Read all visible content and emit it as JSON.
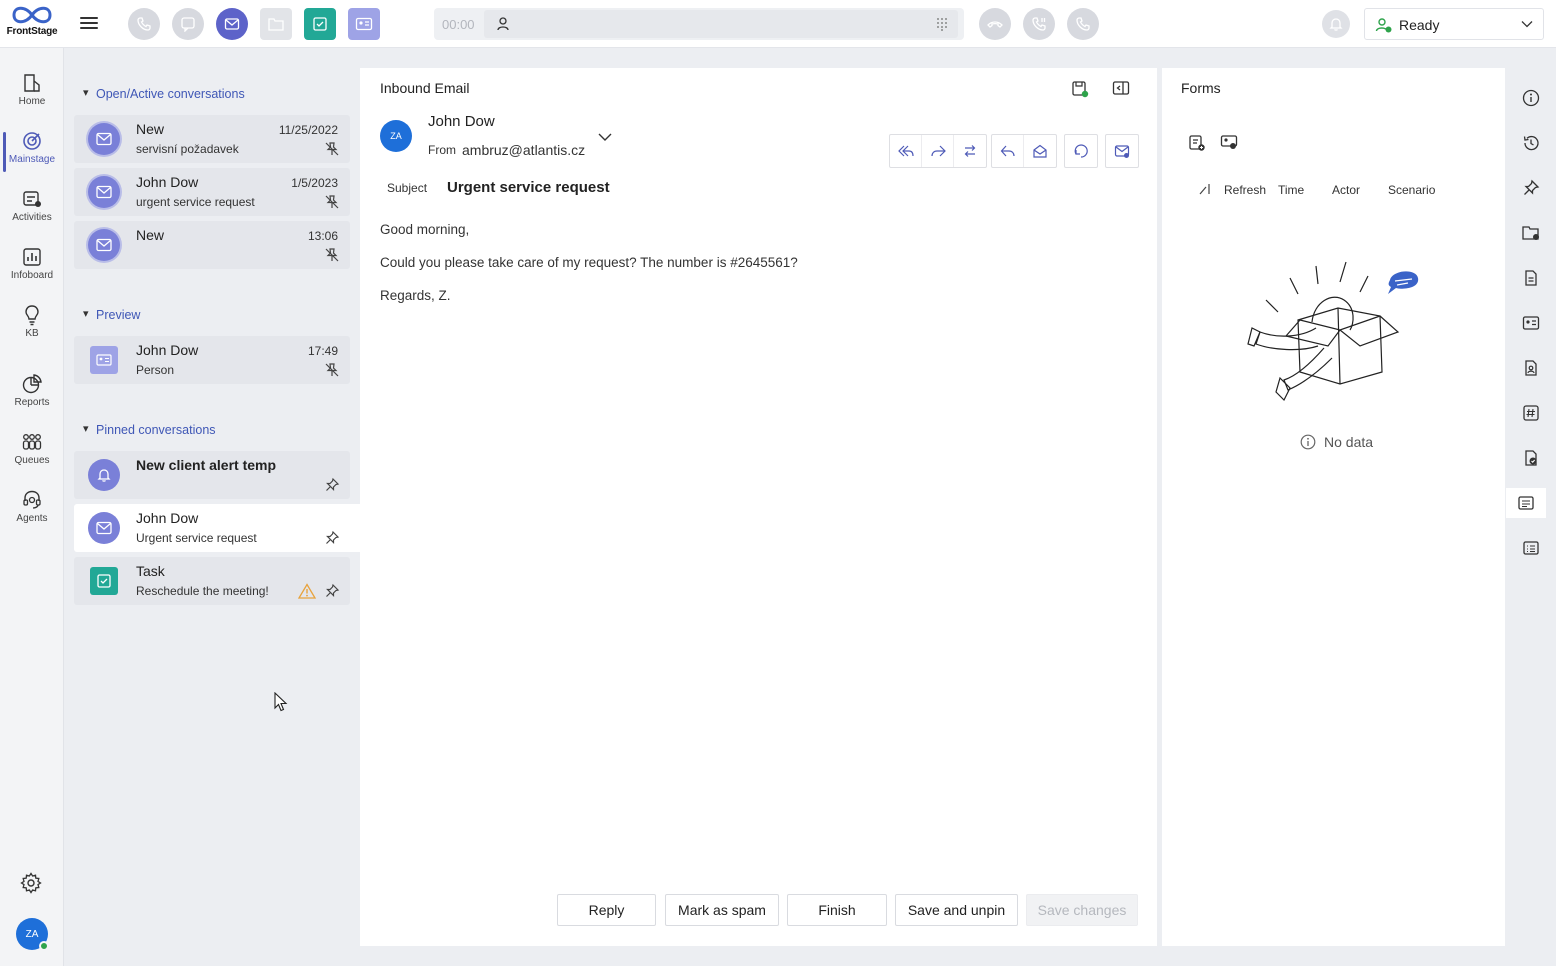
{
  "app": {
    "logo_text": "FrontStage"
  },
  "topbar": {
    "timer": "00:00",
    "status": "Ready"
  },
  "nav": [
    {
      "label": "Home",
      "icon": "home-icon"
    },
    {
      "label": "Mainstage",
      "icon": "target-icon",
      "active": true
    },
    {
      "label": "Activities",
      "icon": "activities-icon"
    },
    {
      "label": "Infoboard",
      "icon": "chart-icon"
    },
    {
      "label": "KB",
      "icon": "bulb-icon"
    },
    {
      "label": "Reports",
      "icon": "pie-icon"
    },
    {
      "label": "Queues",
      "icon": "queue-icon"
    },
    {
      "label": "Agents",
      "icon": "headset-icon"
    }
  ],
  "user": {
    "initials": "ZA"
  },
  "sections": {
    "open": "Open/Active conversations",
    "preview": "Preview",
    "pinned": "Pinned conversations"
  },
  "open_conversations": [
    {
      "title": "New",
      "sub": "servisní požadavek",
      "date": "11/25/2022"
    },
    {
      "title": "John Dow",
      "sub": "urgent service request",
      "date": "1/5/2023"
    },
    {
      "title": "New",
      "sub": "",
      "date": "13:06"
    }
  ],
  "preview_conversations": [
    {
      "title": "John Dow",
      "sub": "Person",
      "date": "17:49"
    }
  ],
  "pinned_conversations": [
    {
      "title": "New client alert temp",
      "sub": ""
    },
    {
      "title": "John Dow",
      "sub": "Urgent service request"
    },
    {
      "title": "Task",
      "sub": "Reschedule the meeting!"
    }
  ],
  "email": {
    "panel_title": "Inbound Email",
    "avatar": "ZA",
    "sender": "John Dow",
    "from_label": "From",
    "from_addr": "ambruz@atlantis.cz",
    "subject_label": "Subject",
    "subject": "Urgent service request",
    "body": [
      "Good morning,",
      "Could you please take care of my request? The number is #2645561?",
      "Regards, Z."
    ],
    "buttons": {
      "reply": "Reply",
      "spam": "Mark as spam",
      "finish": "Finish",
      "save_unpin": "Save and unpin",
      "save_changes": "Save changes"
    }
  },
  "forms": {
    "title": "Forms",
    "columns": [
      "Refresh",
      "Time",
      "Actor",
      "Scenario"
    ],
    "empty": "No data"
  },
  "colors": {
    "accent": "#4e5ab7",
    "mail": "#5d63c9",
    "task": "#22a896",
    "avatar": "#1e6fd9"
  }
}
